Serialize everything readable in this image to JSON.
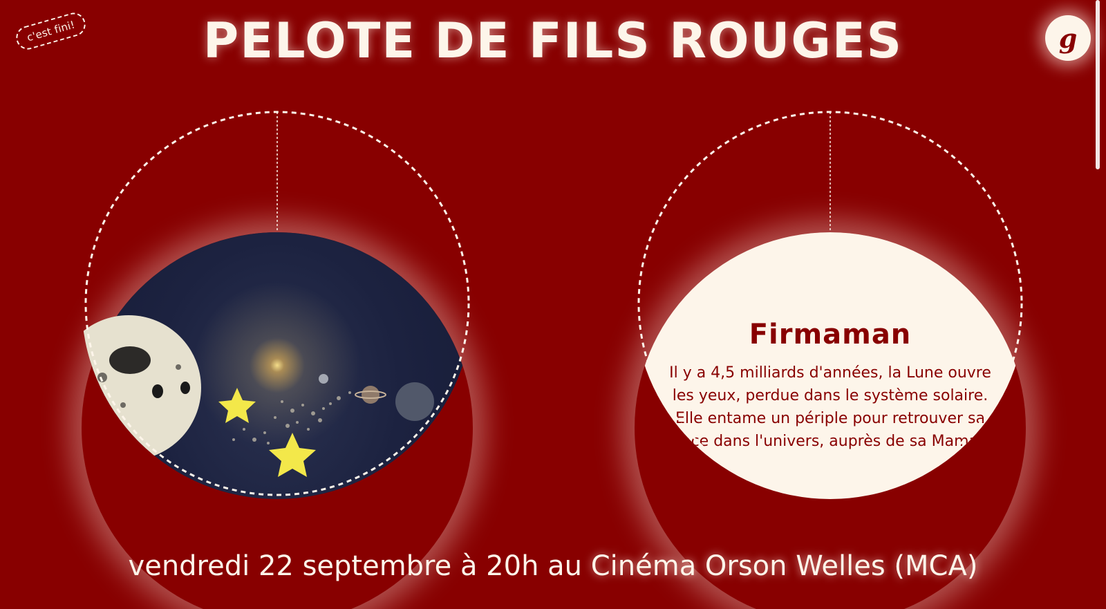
{
  "header": {
    "badge": "c'est fini!",
    "title": "PELOTE DE FILS ROUGES",
    "logo_letter": "g"
  },
  "cards": [
    {
      "type": "image",
      "image_alt": "Firmaman film still: smiling moon and stars in the solar system"
    },
    {
      "type": "text",
      "title": "Firmaman",
      "text": "Il y a 4,5 milliards d'années, la Lune ouvre les yeux, perdue dans le système solaire. Elle entame un périple pour retrouver sa place dans l'univers, auprès de sa Maman."
    }
  ],
  "footer": {
    "prefix": "vendredi 22 septembre à 20h au ",
    "place": "Cinéma Orson Welles (MCA)"
  },
  "colors": {
    "background": "#880000",
    "cream": "#fdf5ea",
    "space": "#1c2240"
  }
}
